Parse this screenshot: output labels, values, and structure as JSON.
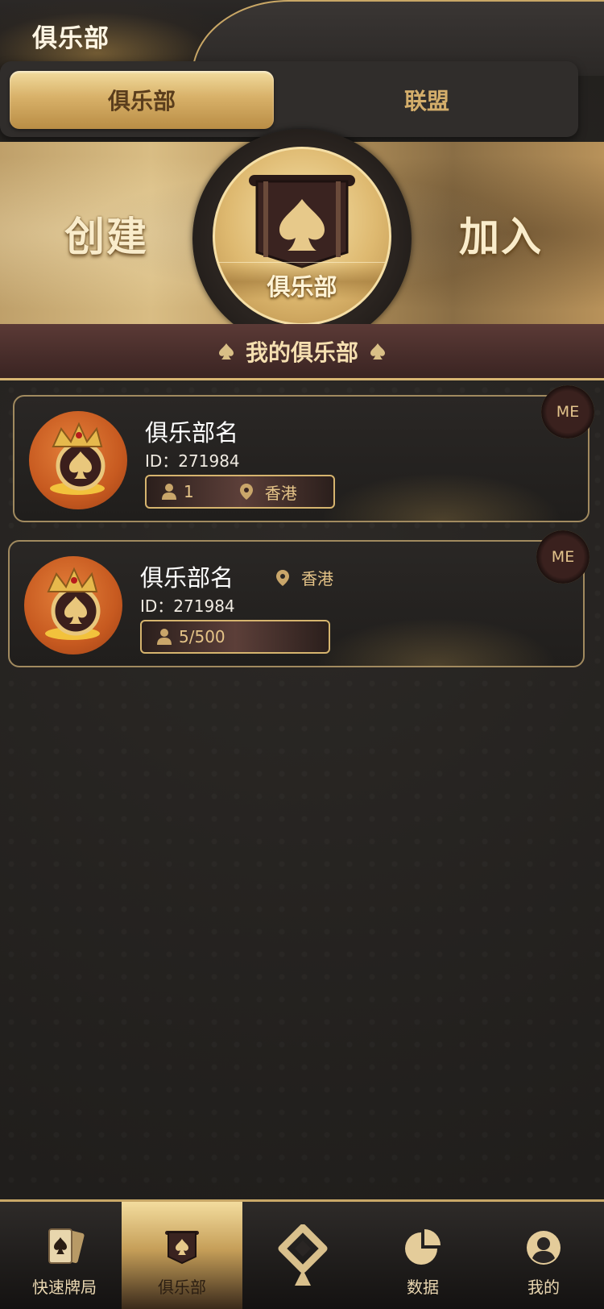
{
  "header": {
    "title": "俱乐部"
  },
  "tabs": [
    {
      "label": "俱乐部",
      "active": true
    },
    {
      "label": "联盟",
      "active": false
    }
  ],
  "banner": {
    "create_label": "创建",
    "join_label": "加入",
    "center_label": "俱乐部"
  },
  "section": {
    "title": "我的俱乐部"
  },
  "clubs": [
    {
      "name": "俱乐部名",
      "id_text": "ID：271984",
      "members": "1",
      "location": "香港",
      "badge": "ME"
    },
    {
      "name": "俱乐部名",
      "id_text": "ID：271984",
      "members": "5/500",
      "location": "香港",
      "badge": "ME"
    }
  ],
  "nav": {
    "items": [
      {
        "label": "快速牌局",
        "icon": "cards-icon",
        "active": false
      },
      {
        "label": "俱乐部",
        "icon": "club-banner-icon",
        "active": true
      },
      {
        "label": "",
        "icon": "brand-logo-icon",
        "active": false
      },
      {
        "label": "数据",
        "icon": "pie-chart-icon",
        "active": false
      },
      {
        "label": "我的",
        "icon": "user-icon",
        "active": false
      }
    ]
  },
  "colors": {
    "gold": "#d6b46e",
    "dark": "#242120",
    "accent_text": "#e5c488"
  }
}
